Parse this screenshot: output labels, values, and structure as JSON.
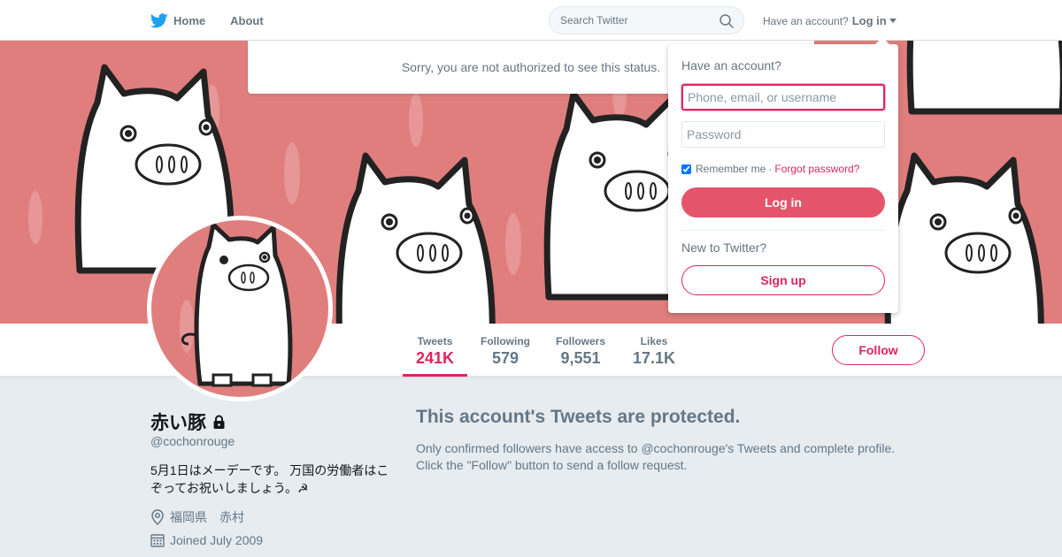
{
  "nav": {
    "home_label": "Home",
    "about_label": "About",
    "search_placeholder": "Search Twitter",
    "account_prompt": "Have an account?",
    "login_label": "Log in"
  },
  "status_message": "Sorry, you are not authorized to see this status.",
  "login_dropdown": {
    "heading": "Have an account?",
    "username_placeholder": "Phone, email, or username",
    "password_placeholder": "Password",
    "remember_label": "Remember me",
    "separator": "·",
    "forgot_label": "Forgot password?",
    "login_button": "Log in",
    "new_prompt": "New to Twitter?",
    "signup_button": "Sign up"
  },
  "stats": [
    {
      "label": "Tweets",
      "value": "241K",
      "active": true
    },
    {
      "label": "Following",
      "value": "579",
      "active": false
    },
    {
      "label": "Followers",
      "value": "9,551",
      "active": false
    },
    {
      "label": "Likes",
      "value": "17.1K",
      "active": false
    }
  ],
  "follow_button": "Follow",
  "profile": {
    "name": "赤い豚",
    "handle": "@cochonrouge",
    "bio": "5月1日はメーデーです。 万国の労働者はこぞってお祝いしましょう。☭",
    "location": "福岡県　赤村",
    "joined": "Joined July 2009"
  },
  "protected": {
    "title": "This account's Tweets are protected.",
    "description": "Only confirmed followers have access to @cochonrouge's Tweets and complete profile. Click the \"Follow\" button to send a follow request."
  },
  "colors": {
    "accent": "#e0245e",
    "banner": "#e07e7e",
    "twitter_blue": "#1da1f2"
  },
  "icons": [
    "twitter-bird-icon",
    "search-icon",
    "caret-down-icon",
    "lock-icon",
    "location-icon",
    "calendar-icon"
  ]
}
